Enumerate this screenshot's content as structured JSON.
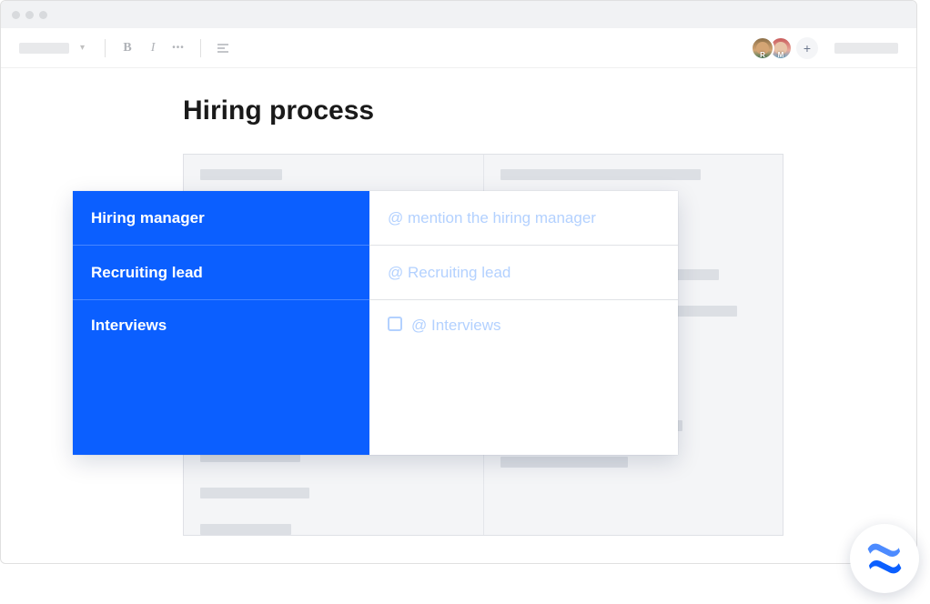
{
  "page": {
    "title": "Hiring process"
  },
  "toolbar": {
    "avatars": [
      {
        "letter": "R"
      },
      {
        "letter": "M"
      }
    ]
  },
  "popup": {
    "rows": [
      {
        "label": "Hiring manager",
        "value": "@ mention the hiring manager",
        "checkbox": false
      },
      {
        "label": "Recruiting lead",
        "value": "@ Recruiting lead",
        "checkbox": false
      },
      {
        "label": "Interviews",
        "value": "@ Interviews",
        "checkbox": true
      }
    ]
  },
  "colors": {
    "primary": "#0b5fff",
    "placeholder": "#b3d1ff"
  }
}
